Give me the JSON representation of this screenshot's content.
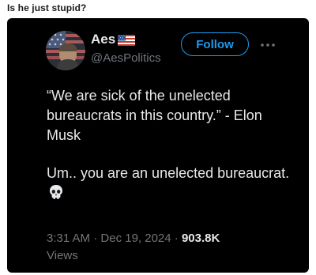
{
  "post": {
    "title": "Is he just stupid?"
  },
  "tweet": {
    "display_name": "Aes",
    "handle": "@AesPolitics",
    "follow_label": "Follow",
    "text_line1": "“We are sick of the unelected bureaucrats in this country.” - Elon Musk",
    "text_line2": "Um.. you are an unelected bureaucrat.",
    "time": "3:31 AM",
    "separator1": " · ",
    "date": "Dec 19, 2024",
    "separator2": " · ",
    "views_count": "903.8K",
    "views_label": "Views"
  },
  "icons": {
    "flag": "us-flag-icon",
    "more": "more-options-icon",
    "skull": "skull-emoji-icon"
  },
  "colors": {
    "card_background": "#000000",
    "primary_text": "#e7e9ea",
    "secondary_text": "#71767b",
    "accent": "#1d9bf0"
  }
}
